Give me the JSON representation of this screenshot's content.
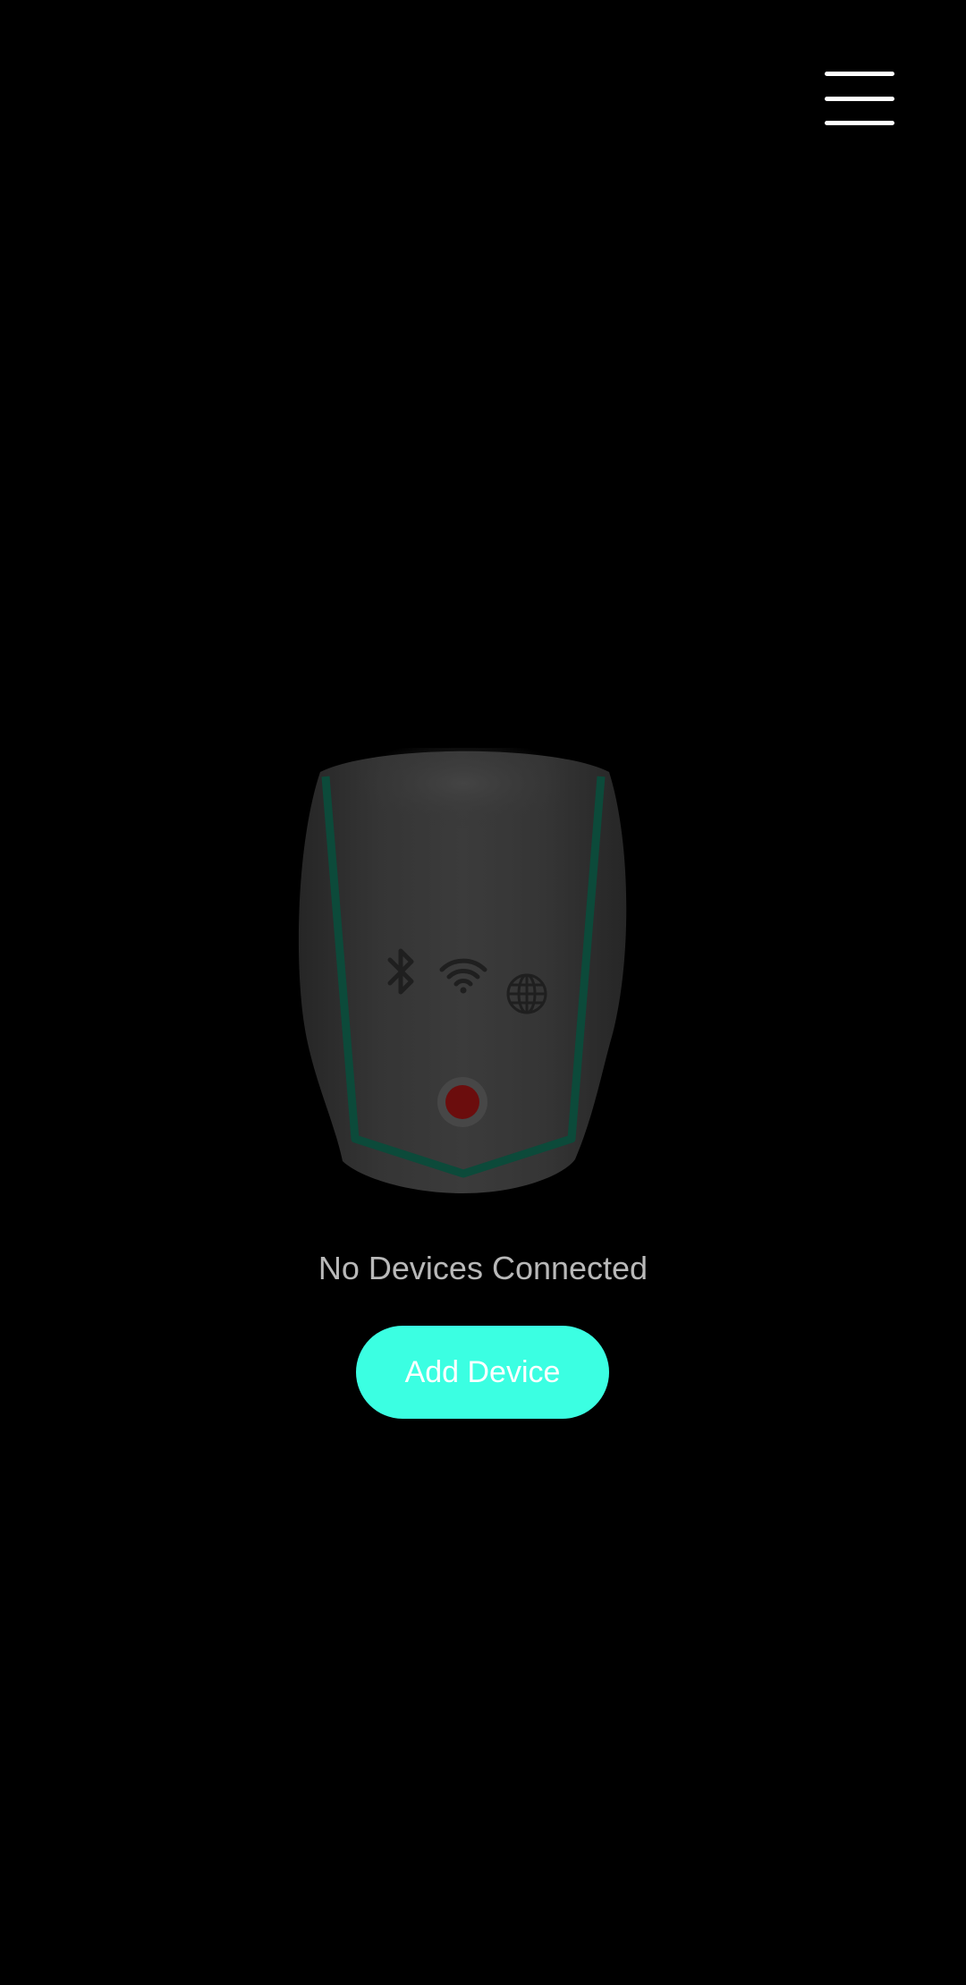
{
  "header": {
    "menu_icon": "hamburger-menu-icon"
  },
  "device": {
    "status_icons": [
      "bluetooth-icon",
      "wifi-icon",
      "globe-icon"
    ],
    "indicator_color": "#6b0d0d",
    "accent_color": "#0c4a3a"
  },
  "main": {
    "status_text": "No Devices Connected",
    "add_button_label": "Add Device"
  },
  "colors": {
    "background": "#000000",
    "accent": "#3bffe2",
    "status_text": "#b9b9b9"
  }
}
